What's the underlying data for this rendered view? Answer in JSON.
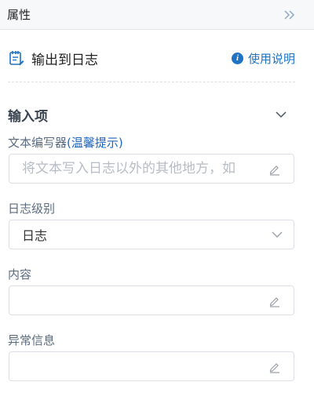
{
  "panel": {
    "title": "属性"
  },
  "node": {
    "title": "输出到日志",
    "help_label": "使用说明"
  },
  "section": {
    "title": "输入项"
  },
  "fields": {
    "text": {
      "label": "文本编写器",
      "tip": "(温馨提示)",
      "placeholder": "将文本写入日志以外的其他地方，如",
      "value": ""
    },
    "level": {
      "label": "日志级别",
      "selected": "日志"
    },
    "content": {
      "label": "内容",
      "value": ""
    },
    "exception": {
      "label": "异常信息",
      "value": ""
    }
  },
  "colors": {
    "accent": "#1f73c4",
    "label": "#5b6b80",
    "border": "#dcdfe6"
  }
}
